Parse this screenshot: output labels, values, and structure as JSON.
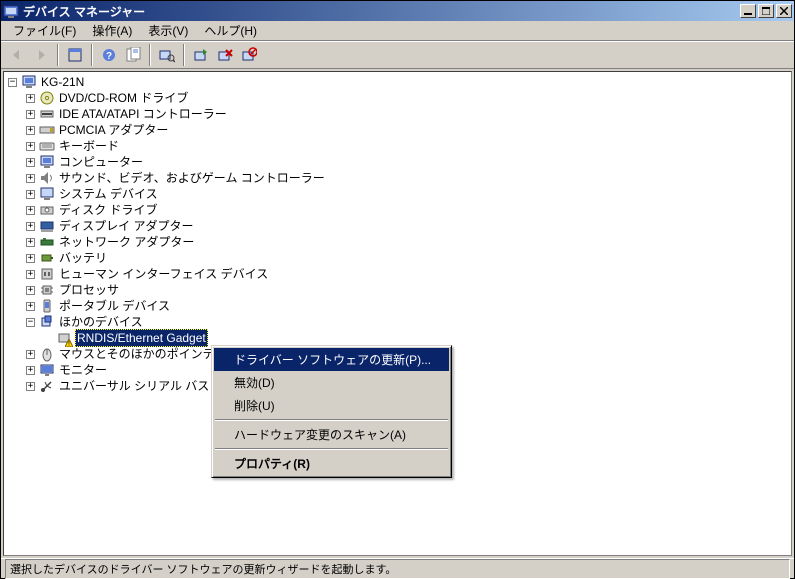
{
  "title": "デバイス マネージャー",
  "menu": {
    "file": "ファイル(F)",
    "action": "操作(A)",
    "view": "表示(V)",
    "help": "ヘルプ(H)"
  },
  "root": "KG-21N",
  "nodes": {
    "dvd": "DVD/CD-ROM ドライブ",
    "ide": "IDE ATA/ATAPI コントローラー",
    "pcmcia": "PCMCIA アダプター",
    "keyboard": "キーボード",
    "computer": "コンピューター",
    "sound": "サウンド、ビデオ、およびゲーム コントローラー",
    "system": "システム デバイス",
    "disk": "ディスク ドライブ",
    "display": "ディスプレイ アダプター",
    "network": "ネットワーク アダプター",
    "battery": "バッテリ",
    "hid": "ヒューマン インターフェイス デバイス",
    "cpu": "プロセッサ",
    "portable": "ポータブル デバイス",
    "other": "ほかのデバイス",
    "rndis": "RNDIS/Ethernet Gadget",
    "mouse": "マウスとそのほかのポインティング",
    "monitor": "モニター",
    "usb": "ユニバーサル シリアル バス コン"
  },
  "context": {
    "update": "ドライバー ソフトウェアの更新(P)...",
    "disable": "無効(D)",
    "uninstall": "削除(U)",
    "scan": "ハードウェア変更のスキャン(A)",
    "properties": "プロパティ(R)"
  },
  "status": "選択したデバイスのドライバー ソフトウェアの更新ウィザードを起動します。"
}
